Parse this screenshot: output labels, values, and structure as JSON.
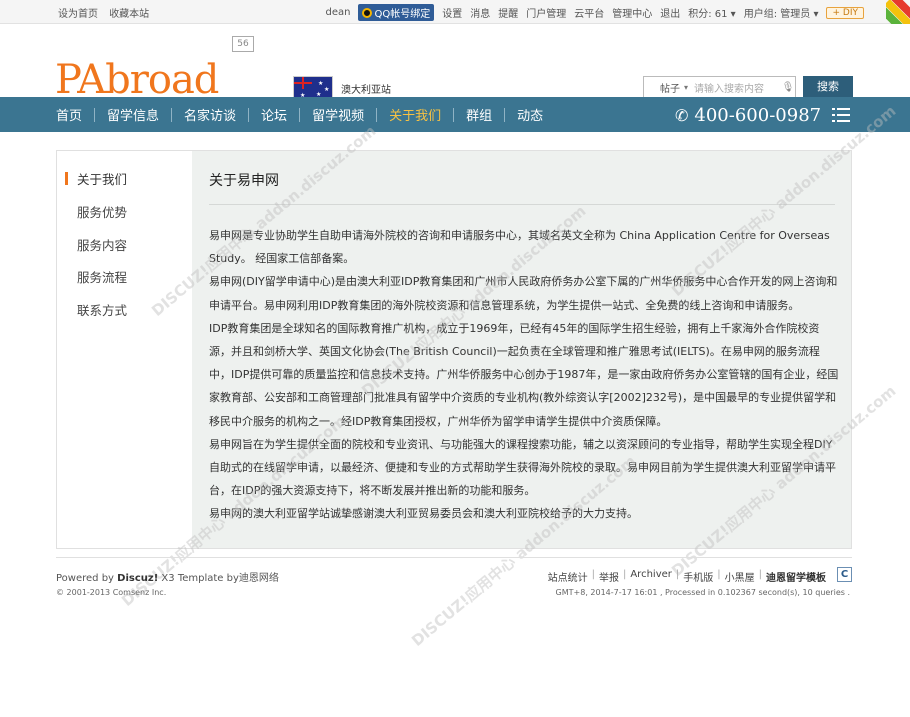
{
  "topbar": {
    "set_home": "设为首页",
    "bookmark": "收藏本站",
    "user": "dean",
    "qq_bind": "QQ帐号绑定",
    "links": [
      "设置",
      "消息",
      "提醒",
      "门户管理",
      "云平台",
      "管理中心",
      "退出"
    ],
    "points": "积分: 61",
    "user_group": "用户组: 管理员",
    "diy": "DIY"
  },
  "header": {
    "logo": "PAbroad",
    "badge": "56",
    "site_name": "澳大利亚站",
    "search_type": "帖子",
    "search_placeholder": "请输入搜索内容",
    "search_button": "搜索"
  },
  "nav": {
    "items": [
      {
        "label": "首页"
      },
      {
        "label": "留学信息"
      },
      {
        "label": "名家访谈"
      },
      {
        "label": "论坛"
      },
      {
        "label": "留学视频"
      },
      {
        "label": "关于我们",
        "active": true
      },
      {
        "label": "群组"
      },
      {
        "label": "动态"
      }
    ],
    "phone": "400-600-0987"
  },
  "sidebar": {
    "items": [
      {
        "label": "关于我们",
        "current": true
      },
      {
        "label": "服务优势"
      },
      {
        "label": "服务内容"
      },
      {
        "label": "服务流程"
      },
      {
        "label": "联系方式"
      }
    ]
  },
  "content": {
    "title": "关于易申网",
    "paragraphs": [
      "易申网是专业协助学生自助申请海外院校的咨询和申请服务中心，其域名英文全称为 China Application Centre for Overseas Study。 经国家工信部备案。",
      "易申网(DIY留学申请中心)是由澳大利亚IDP教育集团和广州市人民政府侨务办公室下属的广州华侨服务中心合作开发的网上咨询和申请平台。易申网利用IDP教育集团的海外院校资源和信息管理系统，为学生提供一站式、全免费的线上咨询和申请服务。",
      "IDP教育集团是全球知名的国际教育推广机构，成立于1969年，已经有45年的国际学生招生经验，拥有上千家海外合作院校资源，并且和剑桥大学、英国文化协会(The British Council)一起负责在全球管理和推广雅思考试(IELTS)。在易申网的服务流程中，IDP提供可靠的质量监控和信息技术支持。广州华侨服务中心创办于1987年，是一家由政府侨务办公室管辖的国有企业，经国家教育部、公安部和工商管理部门批准具有留学中介资质的专业机构(教外综资认字[2002]232号)，是中国最早的专业提供留学和移民中介服务的机构之一。经IDP教育集团授权，广州华侨为留学申请学生提供中介资质保障。",
      "易申网旨在为学生提供全面的院校和专业资讯、与功能强大的课程搜索功能，辅之以资深顾问的专业指导，帮助学生实现全程DIY自助式的在线留学申请，以最经济、便捷和专业的方式帮助学生获得海外院校的录取。易申网目前为学生提供澳大利亚留学申请平台，在IDP的强大资源支持下，将不断发展并推出新的功能和服务。",
      "易申网的澳大利亚留学站诚挚感谢澳大利亚贸易委员会和澳大利亚院校给予的大力支持。"
    ]
  },
  "footer": {
    "powered_prefix": "Powered by ",
    "powered_brand": "Discuz!",
    "powered_version": " X3  Template by迪恩网络",
    "copyright": "© 2001-2013 Comsenz Inc.",
    "links": [
      "站点统计",
      "举报",
      "Archiver",
      "手机版",
      "小黑屋"
    ],
    "strong_link": "迪恩留学模板",
    "gmt": "GMT+8, 2014-7-17 16:01 , Processed in 0.102367 second(s), 10 queries ."
  },
  "watermark": "DISCUZ!应用中心 addon.discuz.com"
}
